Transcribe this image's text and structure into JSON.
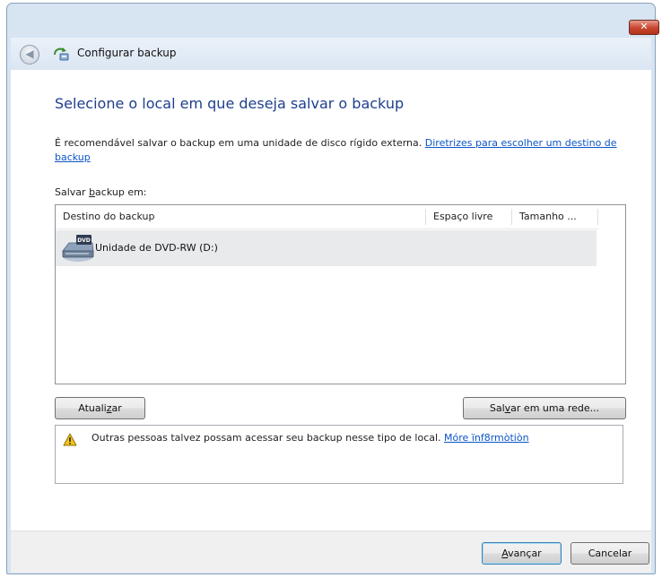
{
  "window": {
    "title": "Configurar backup",
    "close_glyph": "✕"
  },
  "page": {
    "heading": "Selecione o local em que deseja salvar o backup",
    "intro_text": "É recomendável salvar o backup em uma unidade de disco rígido externa.",
    "intro_link": "Diretrizes para escolher um destino de backup"
  },
  "list": {
    "caption_prefix": "Salvar ",
    "caption_underlined": "b",
    "caption_suffix": "ackup em:",
    "columns": [
      "Destino do backup",
      "Espaço livre",
      "Tamanho ..."
    ],
    "rows": [
      {
        "name": "Unidade de DVD-RW (D:)",
        "icon": "dvd-drive-icon"
      }
    ]
  },
  "buttons": {
    "refresh_pre": "Atuali",
    "refresh_u": "z",
    "refresh_post": "ar",
    "network_pre": "Sal",
    "network_u": "v",
    "network_post": "ar em uma rede...",
    "next_u": "A",
    "next_post": "vançar",
    "cancel": "Cancelar"
  },
  "warning": {
    "icon": "warning-icon",
    "text": "Outras pessoas talvez possam acessar seu backup nesse tipo de local.",
    "link": "Móre ïnf8rmòtiòn"
  },
  "colors": {
    "heading": "#1e3e8e",
    "link": "#0b55c6",
    "close_button": "#c7452e"
  }
}
